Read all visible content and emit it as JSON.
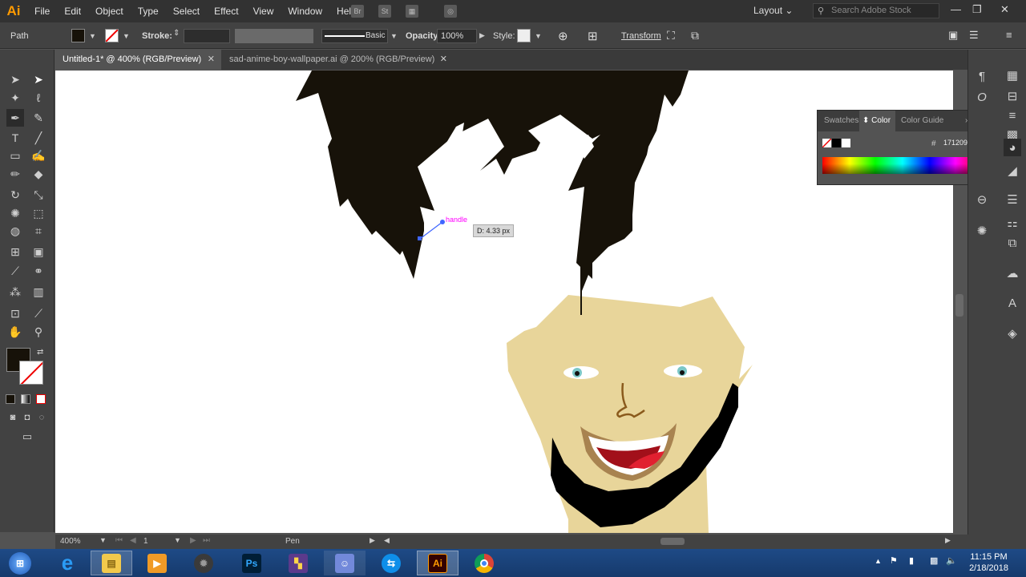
{
  "app": {
    "logo": "Ai",
    "accent": "#ff9a00"
  },
  "menu": [
    "File",
    "Edit",
    "Object",
    "Type",
    "Select",
    "Effect",
    "View",
    "Window",
    "Help"
  ],
  "menubar_right": {
    "workspace": "Layout",
    "search_placeholder": "Search Adobe Stock"
  },
  "control_bar": {
    "selection": "Path",
    "fill_color": "#171209",
    "stroke_label": "Stroke:",
    "brush_label": "Basic",
    "opacity_label": "Opacity:",
    "opacity_value": "100%",
    "style_label": "Style:",
    "transform_label": "Transform"
  },
  "tabs": [
    {
      "title": "Untitled-1* @ 400% (RGB/Preview)",
      "active": true
    },
    {
      "title": "sad-anime-boy-wallpaper.ai @ 200% (RGB/Preview)",
      "active": false
    }
  ],
  "tools": [
    "selection-icon",
    "direct-selection-icon",
    "magic-wand-icon",
    "lasso-icon",
    "pen-icon",
    "curvature-icon",
    "type-icon",
    "line-icon",
    "rectangle-icon",
    "paintbrush-icon",
    "shaper-icon",
    "eraser-icon",
    "rotate-icon",
    "scale-icon",
    "warp-icon",
    "free-transform-icon",
    "shape-builder-icon",
    "perspective-icon",
    "mesh-icon",
    "gradient-icon",
    "eyedropper-icon",
    "graph-icon",
    "artboard-icon",
    "slice-icon",
    "hand-icon",
    "zoom-icon"
  ],
  "canvas": {
    "smart_guide_label": "handle",
    "measure_tooltip": "D: 4.33 px",
    "smart_guide_color": "#ff00ff"
  },
  "color_panel": {
    "tabs": [
      "Swatches",
      "Color",
      "Color Guide"
    ],
    "active_tab": "Color",
    "hex_prefix": "#",
    "hex_value": "171209"
  },
  "status_bar": {
    "zoom": "400%",
    "artboard": "1",
    "tool": "Pen"
  },
  "taskbar": {
    "apps": [
      "start-orb",
      "internet-explorer",
      "file-explorer",
      "media-player",
      "grenade-app",
      "photoshop",
      "video-editor",
      "discord",
      "teamviewer",
      "illustrator",
      "chrome"
    ],
    "time": "11:15 PM",
    "date": "2/18/2018"
  }
}
